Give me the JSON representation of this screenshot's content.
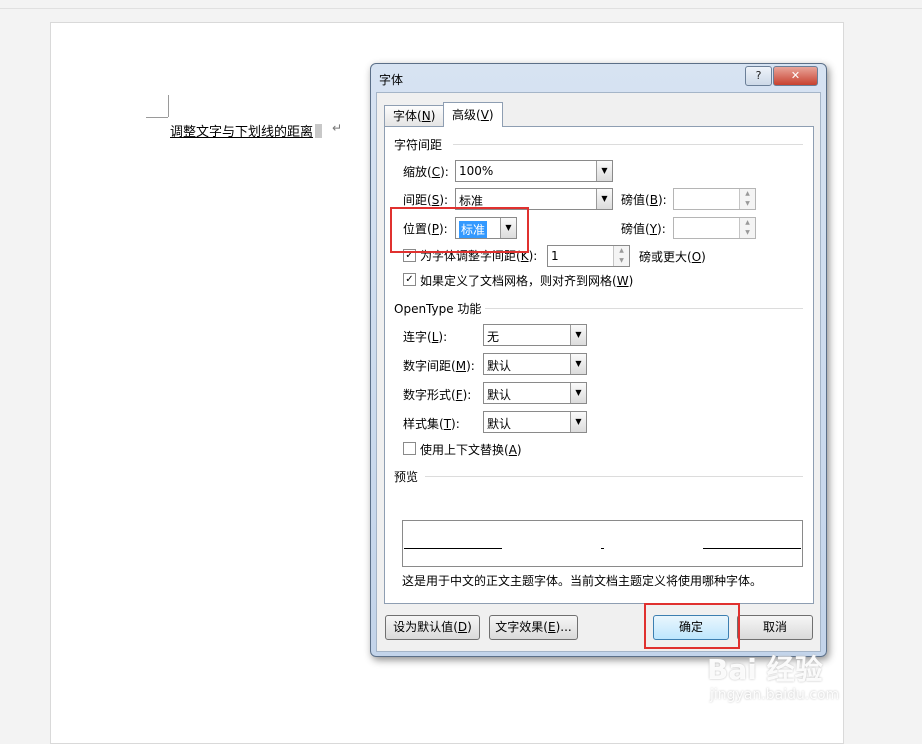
{
  "document": {
    "text": "调整文字与下划线的距离",
    "paragraph_mark": "↵"
  },
  "dialog": {
    "title": "字体",
    "help_label": "?",
    "close_label": "✕",
    "tabs": [
      {
        "label": "字体",
        "key": "N"
      },
      {
        "label": "高级",
        "key": "V"
      }
    ],
    "char_spacing": {
      "heading": "字符间距",
      "scale": {
        "label": "缩放",
        "key": "C",
        "value": "100%"
      },
      "spacing": {
        "label": "间距",
        "key": "S",
        "value": "标准",
        "by_label": "磅值",
        "by_key": "B",
        "by_value": ""
      },
      "position": {
        "label": "位置",
        "key": "P",
        "value": "标准",
        "by_label": "磅值",
        "by_key": "Y",
        "by_value": ""
      },
      "kerning": {
        "label": "为字体调整字间距",
        "key": "K",
        "checked": true,
        "value": "1",
        "suffix": "磅或更大",
        "suffix_key": "O"
      },
      "snap_grid": {
        "label": "如果定义了文档网格，则对齐到网格",
        "key": "W",
        "checked": true
      }
    },
    "opentype": {
      "heading": "OpenType 功能",
      "ligatures": {
        "label": "连字",
        "key": "L",
        "value": "无"
      },
      "number_spacing": {
        "label": "数字间距",
        "key": "M",
        "value": "默认"
      },
      "number_forms": {
        "label": "数字形式",
        "key": "F",
        "value": "默认"
      },
      "stylistic_sets": {
        "label": "样式集",
        "key": "T",
        "value": "默认"
      },
      "contextual": {
        "label": "使用上下文替换",
        "key": "A",
        "checked": false
      }
    },
    "preview": {
      "heading": "预览",
      "note": "这是用于中文的正文主题字体。当前文档主题定义将使用哪种字体。"
    },
    "buttons": {
      "set_default": {
        "label": "设为默认值",
        "key": "D"
      },
      "text_effects": {
        "label": "文字效果",
        "key": "E"
      },
      "ok": "确定",
      "cancel": "取消"
    }
  },
  "watermark": {
    "brand": "Bai 经验",
    "url": "jingyan.baidu.com"
  },
  "colors": {
    "highlight": "#e0312f",
    "selection": "#3399ff"
  }
}
